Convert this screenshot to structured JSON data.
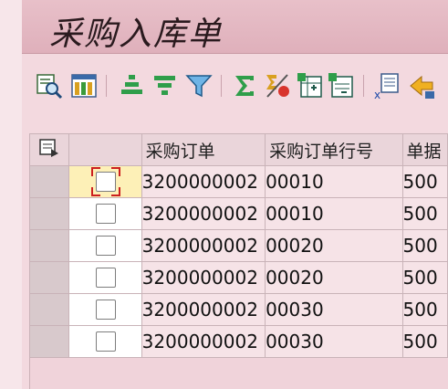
{
  "window": {
    "title": "采购入库单"
  },
  "toolbar": {
    "icons": [
      "details-icon",
      "column-layout-icon",
      "sort-ascending-icon",
      "sort-descending-icon",
      "filter-icon",
      "sum-icon",
      "subtotal-icon",
      "export-spreadsheet-icon",
      "export-word-icon",
      "xml-export-icon",
      "layout-change-icon"
    ]
  },
  "grid": {
    "columns": [
      "采购订单",
      "采购订单行号",
      "单据"
    ],
    "rows": [
      {
        "po": "3200000002",
        "line": "00010",
        "doc": "500",
        "selected": true
      },
      {
        "po": "3200000002",
        "line": "00010",
        "doc": "500",
        "selected": false
      },
      {
        "po": "3200000002",
        "line": "00020",
        "doc": "500",
        "selected": false
      },
      {
        "po": "3200000002",
        "line": "00020",
        "doc": "500",
        "selected": false
      },
      {
        "po": "3200000002",
        "line": "00030",
        "doc": "500",
        "selected": false
      },
      {
        "po": "3200000002",
        "line": "00030",
        "doc": "500",
        "selected": false
      }
    ]
  },
  "colors": {
    "title_bar": "#dfb0bb",
    "background": "#f3d9df",
    "focus": "#cc1f1f"
  }
}
